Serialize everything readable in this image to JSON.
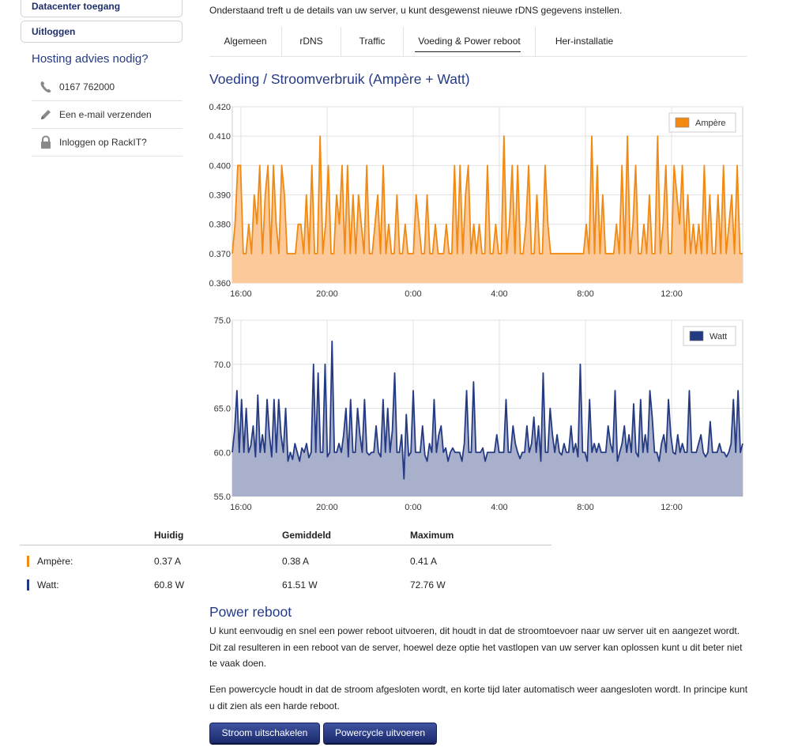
{
  "sidebar": {
    "buttons": [
      "Datacenter toegang",
      "Uitloggen"
    ],
    "advies_title": "Hosting advies nodig?",
    "contacts": [
      {
        "icon": "phone-icon",
        "label": "0167 762000"
      },
      {
        "icon": "pencil-icon",
        "label": "Een e-mail verzenden"
      },
      {
        "icon": "lock-icon",
        "label": "Inloggen op RackIT?"
      }
    ]
  },
  "main": {
    "intro": "Onderstaand treft u de details van uw server, u kunt desgewenst nieuwe rDNS gegevens instellen.",
    "tabs": [
      {
        "label": "Algemeen",
        "active": false
      },
      {
        "label": "rDNS",
        "active": false
      },
      {
        "label": "Traffic",
        "active": false
      },
      {
        "label": "Voeding & Power reboot",
        "active": true
      },
      {
        "label": "Her-installatie",
        "active": false
      }
    ],
    "section_title": "Voeding / Stroomverbruik (Ampère + Watt)"
  },
  "colors": {
    "ampere_line": "#f28a12",
    "ampere_fill": "#fcc99a",
    "watt_line": "#243a82",
    "watt_fill": "#a8b0cc",
    "accent": "#253a84"
  },
  "chart_data": [
    {
      "type": "area",
      "title": "",
      "legend": "Ampère",
      "legend_position": "top-right",
      "grid": true,
      "ylim": [
        0.36,
        0.42
      ],
      "yticks": [
        "0.420",
        "0.410",
        "0.400",
        "0.390",
        "0.380",
        "0.370",
        "0.360"
      ],
      "xticks": [
        "16:00",
        "20:00",
        "0:00",
        "4:00",
        "8:00",
        "12:00"
      ],
      "x_range_hours": [
        15.6,
        39.3
      ],
      "series": [
        {
          "name": "Ampère",
          "values": [
            0.37,
            0.38,
            0.4,
            0.4,
            0.37,
            0.37,
            0.38,
            0.37,
            0.39,
            0.38,
            0.4,
            0.37,
            0.39,
            0.4,
            0.37,
            0.4,
            0.38,
            0.37,
            0.4,
            0.39,
            0.37,
            0.37,
            0.37,
            0.37,
            0.38,
            0.38,
            0.37,
            0.39,
            0.37,
            0.4,
            0.37,
            0.37,
            0.41,
            0.37,
            0.38,
            0.4,
            0.37,
            0.37,
            0.39,
            0.38,
            0.4,
            0.37,
            0.4,
            0.37,
            0.39,
            0.37,
            0.39,
            0.38,
            0.37,
            0.4,
            0.37,
            0.37,
            0.38,
            0.39,
            0.37,
            0.4,
            0.37,
            0.38,
            0.37,
            0.37,
            0.39,
            0.37,
            0.37,
            0.38,
            0.37,
            0.37,
            0.37,
            0.39,
            0.38,
            0.37,
            0.37,
            0.39,
            0.37,
            0.37,
            0.38,
            0.37,
            0.37,
            0.37,
            0.38,
            0.37,
            0.37,
            0.4,
            0.37,
            0.4,
            0.37,
            0.39,
            0.4,
            0.37,
            0.38,
            0.37,
            0.38,
            0.37,
            0.37,
            0.4,
            0.37,
            0.37,
            0.38,
            0.37,
            0.37,
            0.41,
            0.37,
            0.38,
            0.4,
            0.37,
            0.4,
            0.37,
            0.37,
            0.38,
            0.4,
            0.37,
            0.37,
            0.39,
            0.37,
            0.37,
            0.4,
            0.38,
            0.37,
            0.37,
            0.37,
            0.37,
            0.37,
            0.37,
            0.37,
            0.37,
            0.37,
            0.37,
            0.37,
            0.37,
            0.37,
            0.38,
            0.37,
            0.41,
            0.37,
            0.4,
            0.37,
            0.39,
            0.37,
            0.37,
            0.37,
            0.37,
            0.38,
            0.37,
            0.4,
            0.37,
            0.41,
            0.37,
            0.38,
            0.4,
            0.37,
            0.37,
            0.38,
            0.37,
            0.39,
            0.37,
            0.37,
            0.41,
            0.37,
            0.38,
            0.4,
            0.37,
            0.37,
            0.4,
            0.39,
            0.38,
            0.4,
            0.37,
            0.39,
            0.37,
            0.38,
            0.37,
            0.38,
            0.37,
            0.4,
            0.37,
            0.39,
            0.37,
            0.37,
            0.39,
            0.37,
            0.4,
            0.37,
            0.38,
            0.39,
            0.37,
            0.4,
            0.37,
            0.37
          ]
        }
      ]
    },
    {
      "type": "area",
      "title": "",
      "legend": "Watt",
      "legend_position": "top-right",
      "grid": true,
      "ylim": [
        55,
        75
      ],
      "yticks": [
        "75.0",
        "70.0",
        "65.0",
        "60.0",
        "55.0"
      ],
      "xticks": [
        "16:00",
        "20:00",
        "0:00",
        "4:00",
        "8:00",
        "12:00"
      ],
      "x_range_hours": [
        15.6,
        39.3
      ],
      "series": [
        {
          "name": "Watt",
          "values": [
            60,
            62.5,
            67,
            60,
            66,
            60,
            65,
            60,
            60.8,
            63,
            59.5,
            66.5,
            60,
            62,
            60,
            66,
            62,
            59.5,
            66,
            60,
            66,
            62,
            60,
            65,
            59,
            60,
            59.2,
            61,
            60,
            59,
            60.5,
            60,
            61,
            59.4,
            60,
            70,
            60,
            69,
            60,
            60,
            70,
            59.5,
            60,
            72.6,
            60,
            60,
            61,
            60,
            62,
            65,
            59.5,
            66,
            60,
            60,
            65,
            62,
            60,
            66,
            60,
            59.7,
            60,
            60,
            63,
            60,
            59.5,
            66,
            60,
            65,
            60,
            62.5,
            69,
            60,
            60,
            62,
            57,
            64.3,
            59.6,
            60,
            67,
            60,
            60,
            60,
            63,
            59.7,
            59,
            61,
            60,
            66,
            60,
            62,
            63,
            60,
            60.5,
            59,
            60,
            60.5,
            60,
            60,
            60,
            59,
            61,
            67,
            60,
            60,
            68,
            60,
            60,
            60,
            60.5,
            59,
            60,
            60,
            60,
            60,
            62,
            60,
            60,
            60,
            66,
            60,
            60,
            63,
            61,
            60,
            59.3,
            60,
            60,
            63,
            60,
            61,
            64,
            60,
            63,
            59,
            69,
            60,
            60,
            65,
            62,
            60,
            62,
            60,
            59.7,
            61,
            60,
            60,
            63,
            60,
            61,
            59.5,
            70,
            60,
            60,
            59,
            66,
            60,
            61,
            60,
            61,
            60,
            60,
            60,
            63,
            61,
            60,
            67,
            59,
            60,
            61,
            63,
            60,
            62,
            60,
            65.5,
            60,
            59.5,
            66,
            60,
            62,
            60,
            67,
            64,
            60,
            60,
            59,
            61,
            62,
            60,
            66,
            62,
            60,
            59.8,
            62,
            60,
            61,
            60,
            60,
            67,
            60,
            60,
            60,
            61,
            62,
            60,
            59.5,
            60,
            63.5,
            60,
            60,
            60,
            61,
            60,
            60,
            59.5,
            60,
            61,
            66,
            60,
            67,
            60,
            61
          ]
        }
      ]
    }
  ],
  "stats": {
    "headers": [
      "Huidig",
      "Gemiddeld",
      "Maximum"
    ],
    "rows": [
      {
        "label": "Ampère:",
        "current": "0.37 A",
        "average": "0.38 A",
        "maximum": "0.41 A"
      },
      {
        "label": "Watt:",
        "current": "60.8 W",
        "average": "61.51 W",
        "maximum": "72.76 W"
      }
    ]
  },
  "power": {
    "title": "Power reboot",
    "p1_line1": "U kunt eenvoudig en snel een power reboot uitvoeren, dit houdt in dat de stroomtoevoer naar uw server uit en aangezet wordt.",
    "p1_line2": "Dit zal resulteren in een reboot van de server, hoewel deze optie het vastlopen van uw server kan oplossen kunt u dit beter niet",
    "p1_line3": "te vaak doen.",
    "p2_line1": "Een powercycle houdt in dat de stroom afgesloten wordt, en korte tijd later automatisch weer aangesloten wordt. In principe kunt",
    "p2_line2": "u dit zien als een harde reboot.",
    "btn_off": "Stroom uitschakelen",
    "btn_cycle": "Powercycle uitvoeren"
  }
}
